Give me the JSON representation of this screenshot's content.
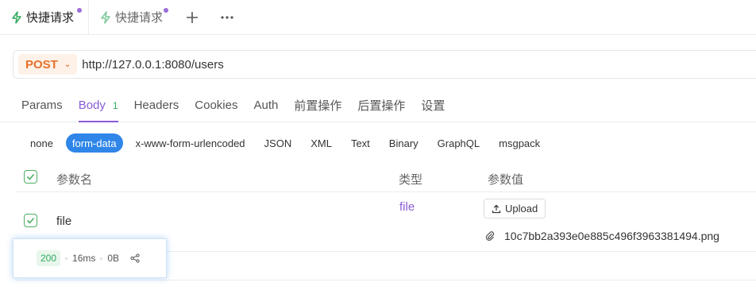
{
  "tabs": [
    {
      "label": "快捷请求",
      "active": true,
      "unsaved": true
    },
    {
      "label": "快捷请求",
      "active": false,
      "unsaved": true
    }
  ],
  "request": {
    "method": "POST",
    "url": "http://127.0.0.1:8080/users"
  },
  "section_tabs": [
    {
      "label": "Params",
      "active": false
    },
    {
      "label": "Body",
      "active": true,
      "count": "1"
    },
    {
      "label": "Headers",
      "active": false
    },
    {
      "label": "Cookies",
      "active": false
    },
    {
      "label": "Auth",
      "active": false
    },
    {
      "label": "前置操作",
      "active": false
    },
    {
      "label": "后置操作",
      "active": false
    },
    {
      "label": "设置",
      "active": false
    }
  ],
  "body_types": [
    "none",
    "form-data",
    "x-www-form-urlencoded",
    "JSON",
    "XML",
    "Text",
    "Binary",
    "GraphQL",
    "msgpack"
  ],
  "body_type_selected": "form-data",
  "params_table": {
    "headers": {
      "name": "参数名",
      "type": "类型",
      "value": "参数值"
    },
    "rows": [
      {
        "name": "file",
        "type": "file",
        "upload_label": "Upload",
        "filename": "10c7bb2a393e0e885c496f3963381494.png"
      }
    ]
  },
  "response_status": {
    "code": "200",
    "time": "16ms",
    "size": "0B"
  },
  "colors": {
    "accent": "#8a5cd6",
    "method": "#e8702a",
    "success": "#2eaa5c",
    "selected_pill": "#2f86e8"
  }
}
